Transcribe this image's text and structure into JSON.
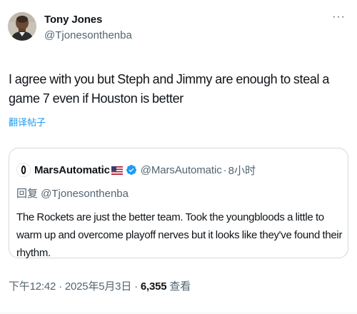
{
  "author": {
    "display_name": "Tony Jones",
    "handle": "@Tjonesonthenba"
  },
  "more_icon": "more-horizontal-icon",
  "more_label": "···",
  "tweet_text": "I agree with you but Steph and Jimmy are enough to steal a game 7 even if Houston is better",
  "translate_label": "翻译帖子",
  "quote": {
    "display_name": "MarsAutomatic",
    "flag_icon": "us-flag-icon",
    "verified_icon": "verified-badge-icon",
    "handle": "@MarsAutomatic",
    "dot": "·",
    "time": "8小时",
    "reply_to": "回复 @Tjonesonthenba",
    "text": "The Rockets are just the better team. Took the youngbloods a little to warm up and overcome playoff nerves but it looks like they've found their rhythm."
  },
  "meta": {
    "time": "下午12:42",
    "dot1": " · ",
    "date": "2025年5月3日",
    "dot2": " · ",
    "views_count": "6,355",
    "views_label": " 查看"
  },
  "colors": {
    "accent": "#1d9bf0",
    "secondary_text": "#536471",
    "primary_text": "#0f1419",
    "border": "#cfd9de"
  }
}
